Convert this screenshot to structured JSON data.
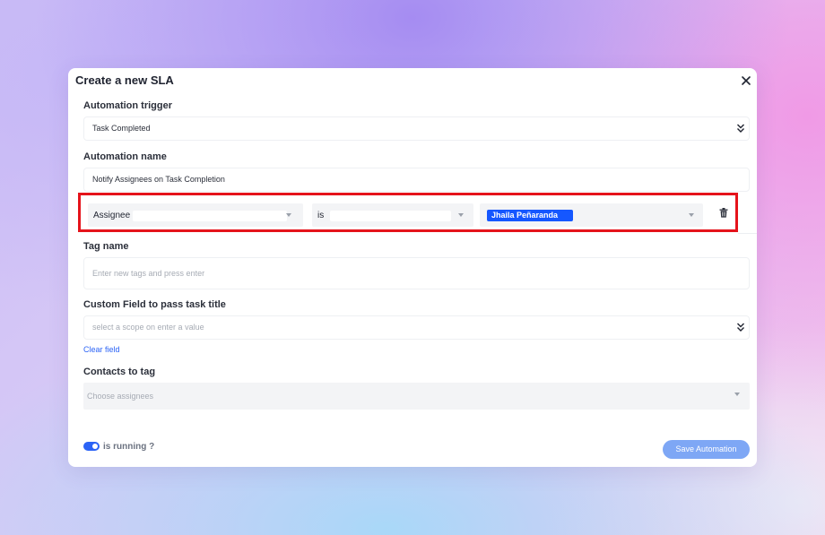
{
  "modal": {
    "title": "Create a new SLA"
  },
  "trigger": {
    "label": "Automation trigger",
    "value": "Task Completed"
  },
  "name": {
    "label": "Automation name",
    "value": "Notify Assignees on Task Completion"
  },
  "condition": {
    "field": "Assignee",
    "operator": "is",
    "value_chip": "Jhaila Peñaranda"
  },
  "tags": {
    "label": "Tag name",
    "placeholder": "Enter new tags and press enter"
  },
  "custom_field": {
    "label": "Custom Field to pass task title",
    "placeholder": "select a scope on enter a value",
    "clear_link": "Clear field"
  },
  "contacts": {
    "label": "Contacts to tag",
    "placeholder": "Choose assignees"
  },
  "footer": {
    "toggle_label": "is running ?",
    "toggle_on": true,
    "save_label": "Save Automation"
  },
  "colors": {
    "highlight_border": "#e5131b",
    "accent": "#2b63f6",
    "chip": "#1557ff",
    "save_button": "#7ea7f5"
  }
}
